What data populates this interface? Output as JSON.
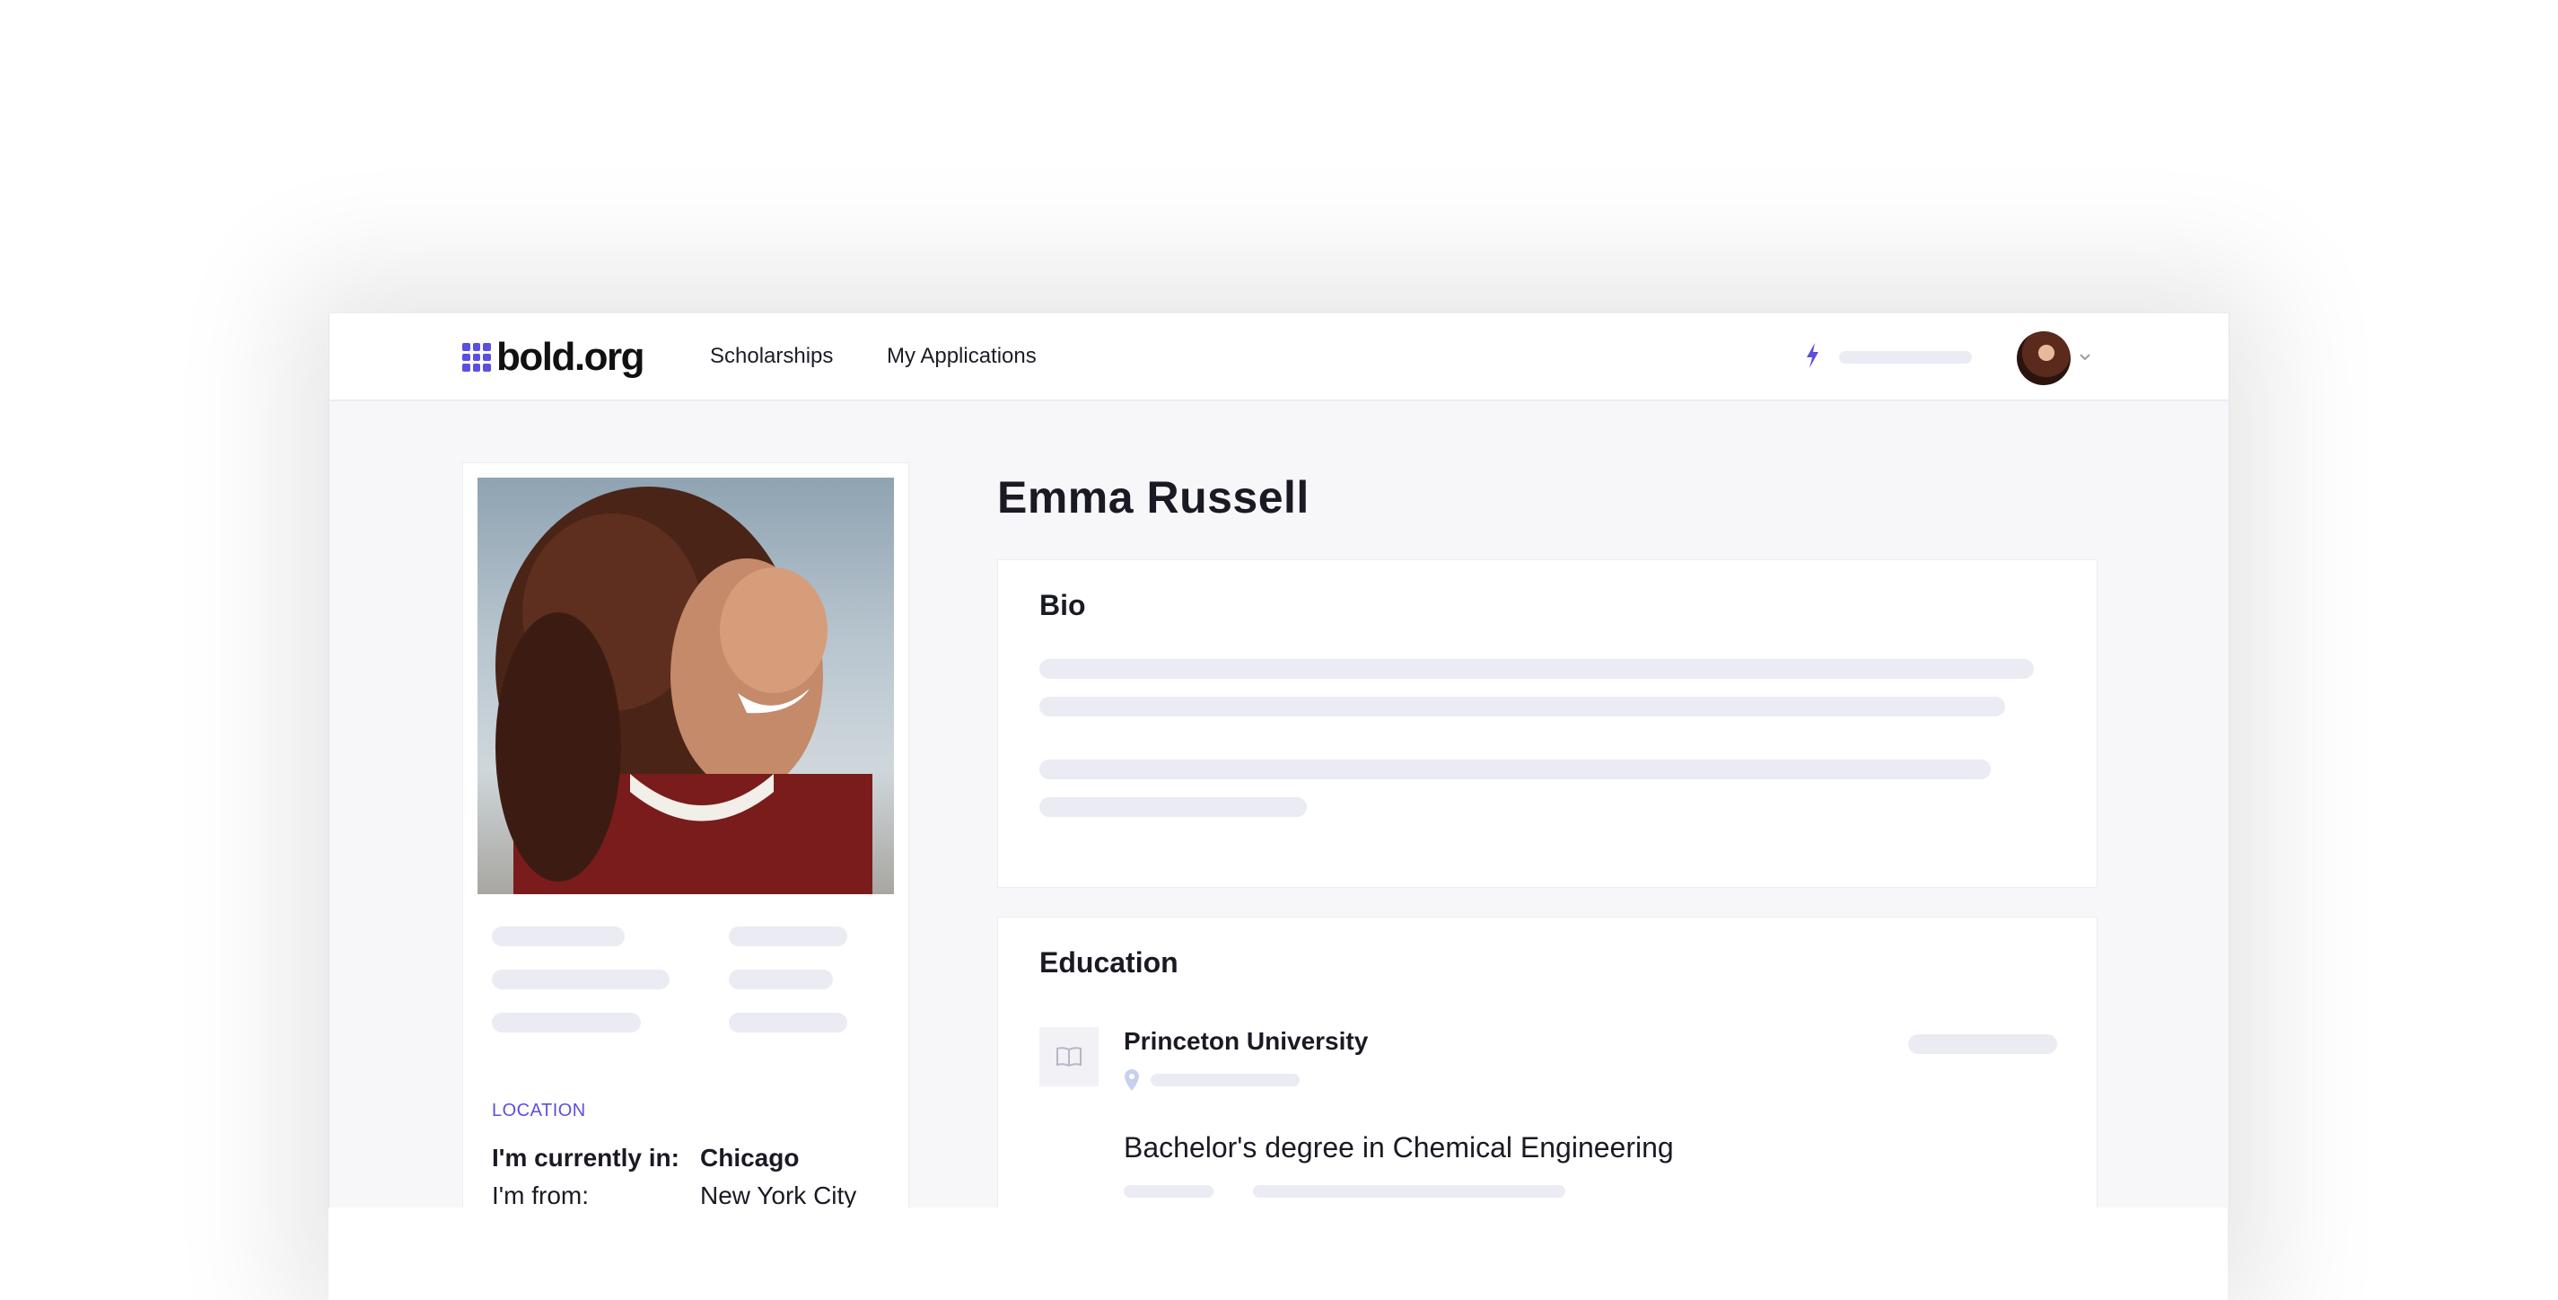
{
  "nav": {
    "logo_text": "bold.org",
    "links": [
      "Scholarships",
      "My Applications"
    ]
  },
  "profile": {
    "name": "Emma Russell"
  },
  "location": {
    "label": "LOCATION",
    "rows": [
      {
        "key": "I'm currently in:",
        "value": "Chicago"
      },
      {
        "key": "I'm from:",
        "value": "New York City"
      }
    ]
  },
  "bio": {
    "title": "Bio"
  },
  "education": {
    "title": "Education",
    "school": "Princeton University",
    "degree": "Bachelor's degree in Chemical Engineering"
  },
  "colors": {
    "brand": "#5b4fe0",
    "skeleton": "#ebebf3",
    "background": "#f7f7f9"
  },
  "icons": [
    "logo-grid-icon",
    "bolt-icon",
    "chevron-down-icon",
    "book-icon",
    "map-pin-icon"
  ]
}
